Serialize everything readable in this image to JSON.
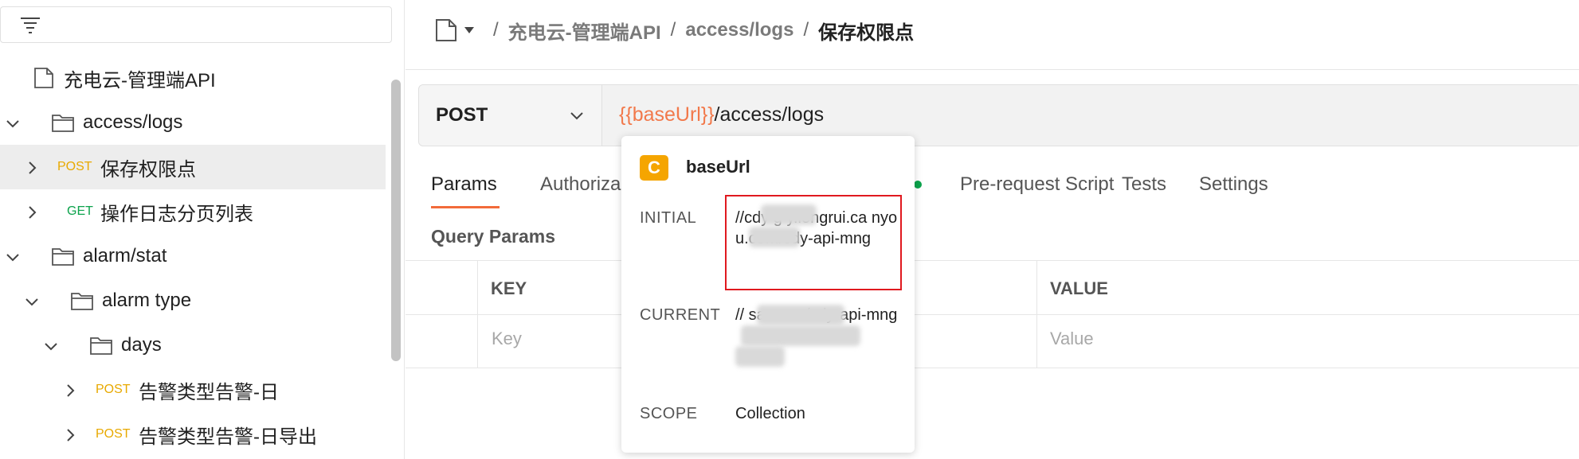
{
  "sidebar": {
    "tree": [
      {
        "label": "充电云-管理端API",
        "type": "collection"
      },
      {
        "label": "access/logs",
        "type": "folder",
        "expanded": true
      },
      {
        "method": "POST",
        "label": "保存权限点",
        "type": "request",
        "selected": true
      },
      {
        "method": "GET",
        "label": "操作日志分页列表",
        "type": "request"
      },
      {
        "label": "alarm/stat",
        "type": "folder",
        "expanded": true
      },
      {
        "label": "alarm type",
        "type": "folder",
        "expanded": true
      },
      {
        "label": "days",
        "type": "folder",
        "expanded": true
      },
      {
        "method": "POST",
        "label": "告警类型告警-日",
        "type": "request"
      },
      {
        "method": "POST",
        "label": "告警类型告警-日导出",
        "type": "request"
      }
    ]
  },
  "breadcrumb": {
    "separator": "/",
    "items": [
      "充电云-管理端API",
      "access/logs"
    ],
    "current": "保存权限点"
  },
  "request": {
    "method": "POST",
    "url_variable": "{{baseUrl}}",
    "url_path": "/access/logs"
  },
  "tabs": [
    {
      "label": "Params",
      "active": true
    },
    {
      "label": "Authoriza"
    },
    {
      "label": "Pre-request Script"
    },
    {
      "label": "Tests"
    },
    {
      "label": "Settings"
    }
  ],
  "params": {
    "section_title": "Query Params",
    "columns": [
      "KEY",
      "VALUE"
    ],
    "key_placeholder": "Key",
    "value_placeholder": "Value"
  },
  "popover": {
    "badge": "C",
    "title": "baseUrl",
    "initial_label": "INITIAL",
    "initial_value": "//cdy g y.longrui.ca nyou.com/cdy-api-mng",
    "current_label": "CURRENT",
    "current_value": "// sa n om/cdy-api-mng",
    "scope_label": "SCOPE",
    "scope_value": "Collection"
  },
  "colors": {
    "accent": "#f26b3a",
    "post": "#e8a900",
    "get": "#0ca34c",
    "variable": "#f2794b",
    "highlight_box": "#e0191f"
  }
}
